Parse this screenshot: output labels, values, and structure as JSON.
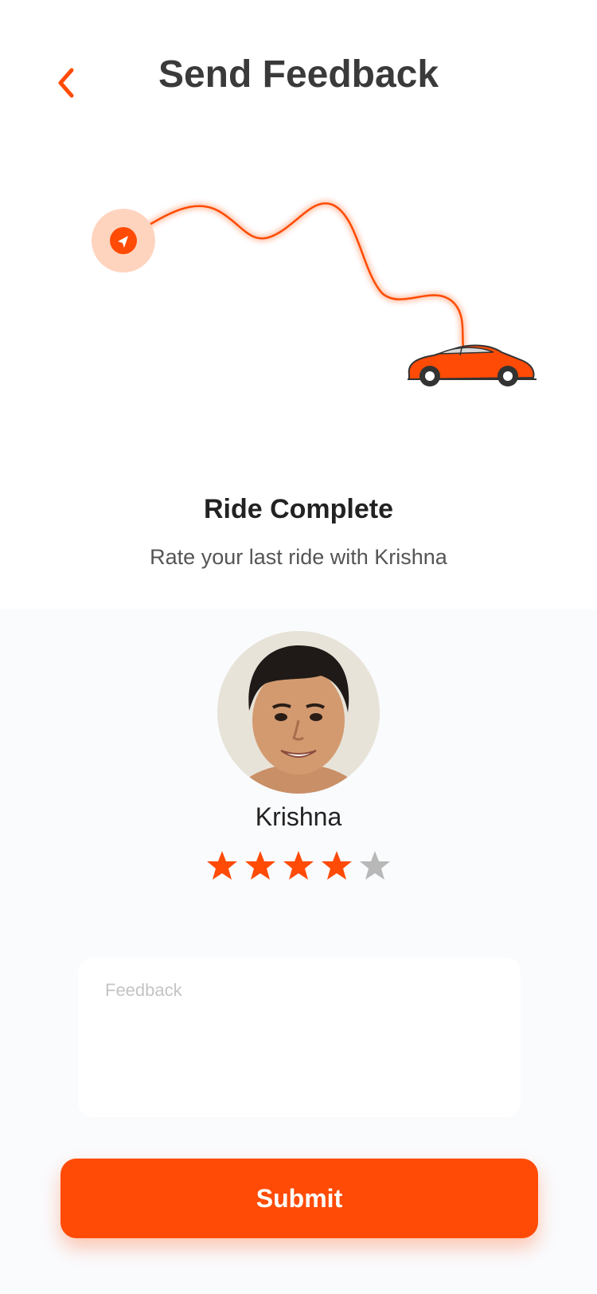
{
  "header": {
    "title": "Send Feedback",
    "back_icon": "chevron-left-icon"
  },
  "ride": {
    "title": "Ride Complete",
    "subtitle": "Rate your last ride with Krishna"
  },
  "driver": {
    "name": "Krishna",
    "rating": 4,
    "max_rating": 5
  },
  "feedback": {
    "placeholder": "Feedback",
    "value": ""
  },
  "submit": {
    "label": "Submit"
  },
  "colors": {
    "accent": "#ff4b05",
    "star_inactive": "#b8b8b8",
    "panel_bg": "#fafbfd"
  }
}
